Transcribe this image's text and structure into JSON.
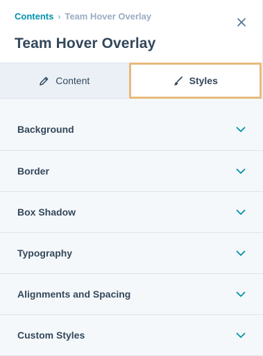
{
  "breadcrumb": {
    "parent": "Contents",
    "separator": "›",
    "current": "Team Hover Overlay"
  },
  "header": {
    "title": "Team Hover Overlay"
  },
  "tabs": [
    {
      "label": "Content",
      "icon": "pencil-icon"
    },
    {
      "label": "Styles",
      "icon": "brush-icon"
    }
  ],
  "sections": [
    {
      "label": "Background"
    },
    {
      "label": "Border"
    },
    {
      "label": "Box Shadow"
    },
    {
      "label": "Typography"
    },
    {
      "label": "Alignments and Spacing"
    },
    {
      "label": "Custom Styles"
    }
  ],
  "colors": {
    "accent": "#0091ae",
    "text": "#33475b",
    "muted": "#99acc2",
    "active_tab_border": "#e8b97a",
    "panel_bg": "#f5f8fa"
  }
}
